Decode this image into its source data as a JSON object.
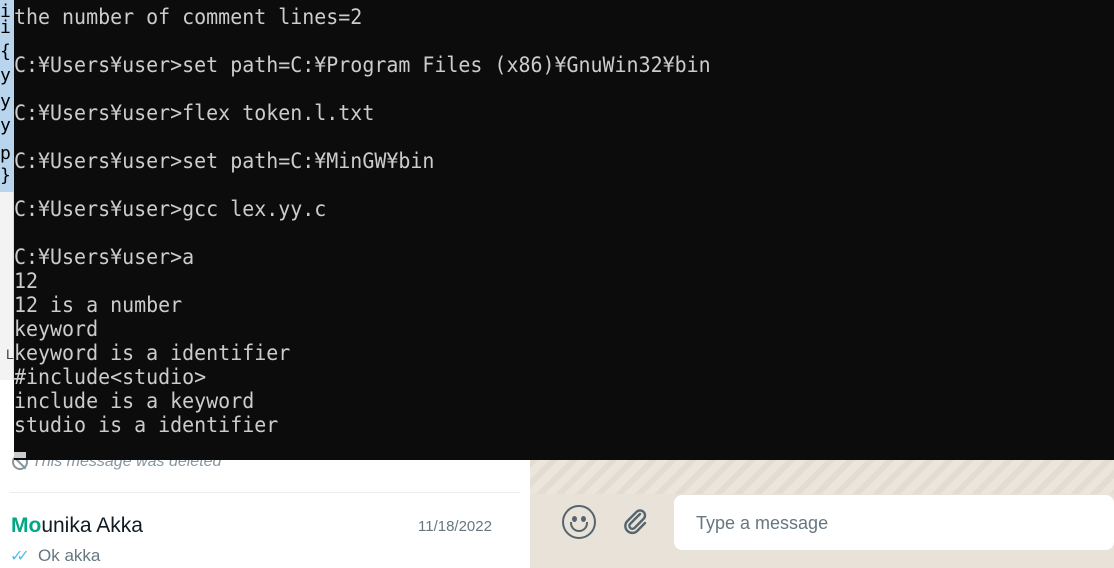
{
  "notepad": {
    "visible_chars": [
      "i",
      "i",
      "{",
      "y",
      "y",
      "y",
      "p",
      "}"
    ],
    "bottom_char": "L"
  },
  "console": {
    "lines": [
      "the number of comment lines=2",
      "",
      "C:¥Users¥user>set path=C:¥Program Files (x86)¥GnuWin32¥bin",
      "",
      "C:¥Users¥user>flex token.l.txt",
      "",
      "C:¥Users¥user>set path=C:¥MinGW¥bin",
      "",
      "C:¥Users¥user>gcc lex.yy.c",
      "",
      "C:¥Users¥user>a",
      "12",
      "12 is a number",
      "keyword",
      "keyword is a identifier",
      "#include<studio>",
      "include is a keyword",
      "studio is a identifier"
    ]
  },
  "chat": {
    "deleted_message": "This message was deleted",
    "contact": {
      "name_highlight": "Mo",
      "name_rest": "unika Akka",
      "date": "11/18/2022",
      "last_message": "Ok akka"
    },
    "composer": {
      "placeholder": "Type a message",
      "emoji_icon": "emoji-icon",
      "attach_icon": "paperclip-icon"
    },
    "colors": {
      "accent": "#00a884",
      "ticks": "#53bdeb",
      "console_bg": "#0c0c0c",
      "console_fg": "#cccccc"
    }
  }
}
